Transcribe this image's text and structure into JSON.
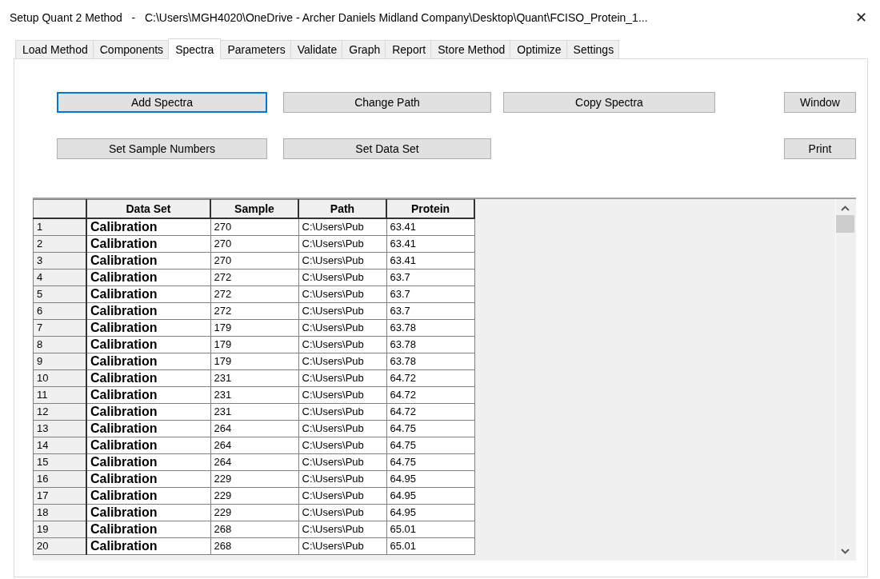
{
  "window": {
    "title": "Setup Quant 2 Method   -   C:\\Users\\MGH4020\\OneDrive - Archer Daniels Midland Company\\Desktop\\Quant\\FCISO_Protein_1...",
    "close": "✕"
  },
  "tabs": [
    {
      "label": "Load Method",
      "selected": false
    },
    {
      "label": "Components",
      "selected": false
    },
    {
      "label": "Spectra",
      "selected": true
    },
    {
      "label": "Parameters",
      "selected": false
    },
    {
      "label": "Validate",
      "selected": false
    },
    {
      "label": "Graph",
      "selected": false
    },
    {
      "label": "Report",
      "selected": false
    },
    {
      "label": "Store Method",
      "selected": false
    },
    {
      "label": "Optimize",
      "selected": false
    },
    {
      "label": "Settings",
      "selected": false
    }
  ],
  "button_rows": [
    [
      {
        "label": "Add Spectra",
        "focused": true
      },
      {
        "label": "Change Path",
        "focused": false
      },
      {
        "label": "Copy Spectra",
        "focused": false
      },
      {
        "label": "Window",
        "focused": false
      }
    ],
    [
      {
        "label": "Set Sample Numbers",
        "focused": false
      },
      {
        "label": "Set Data Set",
        "focused": false
      },
      {
        "label": "Print",
        "focused": false
      }
    ]
  ],
  "table": {
    "columns": [
      "Data Set",
      "Sample",
      "Path",
      "Protein"
    ],
    "rows": [
      {
        "number": "1",
        "data_set": "Calibration",
        "sample": "270",
        "path": "C:\\Users\\Pub",
        "protein": "63.41"
      },
      {
        "number": "2",
        "data_set": "Calibration",
        "sample": "270",
        "path": "C:\\Users\\Pub",
        "protein": "63.41"
      },
      {
        "number": "3",
        "data_set": "Calibration",
        "sample": "270",
        "path": "C:\\Users\\Pub",
        "protein": "63.41"
      },
      {
        "number": "4",
        "data_set": "Calibration",
        "sample": "272",
        "path": "C:\\Users\\Pub",
        "protein": "63.7"
      },
      {
        "number": "5",
        "data_set": "Calibration",
        "sample": "272",
        "path": "C:\\Users\\Pub",
        "protein": "63.7"
      },
      {
        "number": "6",
        "data_set": "Calibration",
        "sample": "272",
        "path": "C:\\Users\\Pub",
        "protein": "63.7"
      },
      {
        "number": "7",
        "data_set": "Calibration",
        "sample": "179",
        "path": "C:\\Users\\Pub",
        "protein": "63.78"
      },
      {
        "number": "8",
        "data_set": "Calibration",
        "sample": "179",
        "path": "C:\\Users\\Pub",
        "protein": "63.78"
      },
      {
        "number": "9",
        "data_set": "Calibration",
        "sample": "179",
        "path": "C:\\Users\\Pub",
        "protein": "63.78"
      },
      {
        "number": "10",
        "data_set": "Calibration",
        "sample": "231",
        "path": "C:\\Users\\Pub",
        "protein": "64.72"
      },
      {
        "number": "11",
        "data_set": "Calibration",
        "sample": "231",
        "path": "C:\\Users\\Pub",
        "protein": "64.72"
      },
      {
        "number": "12",
        "data_set": "Calibration",
        "sample": "231",
        "path": "C:\\Users\\Pub",
        "protein": "64.72"
      },
      {
        "number": "13",
        "data_set": "Calibration",
        "sample": "264",
        "path": "C:\\Users\\Pub",
        "protein": "64.75"
      },
      {
        "number": "14",
        "data_set": "Calibration",
        "sample": "264",
        "path": "C:\\Users\\Pub",
        "protein": "64.75"
      },
      {
        "number": "15",
        "data_set": "Calibration",
        "sample": "264",
        "path": "C:\\Users\\Pub",
        "protein": "64.75"
      },
      {
        "number": "16",
        "data_set": "Calibration",
        "sample": "229",
        "path": "C:\\Users\\Pub",
        "protein": "64.95"
      },
      {
        "number": "17",
        "data_set": "Calibration",
        "sample": "229",
        "path": "C:\\Users\\Pub",
        "protein": "64.95"
      },
      {
        "number": "18",
        "data_set": "Calibration",
        "sample": "229",
        "path": "C:\\Users\\Pub",
        "protein": "64.95"
      },
      {
        "number": "19",
        "data_set": "Calibration",
        "sample": "268",
        "path": "C:\\Users\\Pub",
        "protein": "65.01"
      },
      {
        "number": "20",
        "data_set": "Calibration",
        "sample": "268",
        "path": "C:\\Users\\Pub",
        "protein": "65.01"
      }
    ]
  }
}
